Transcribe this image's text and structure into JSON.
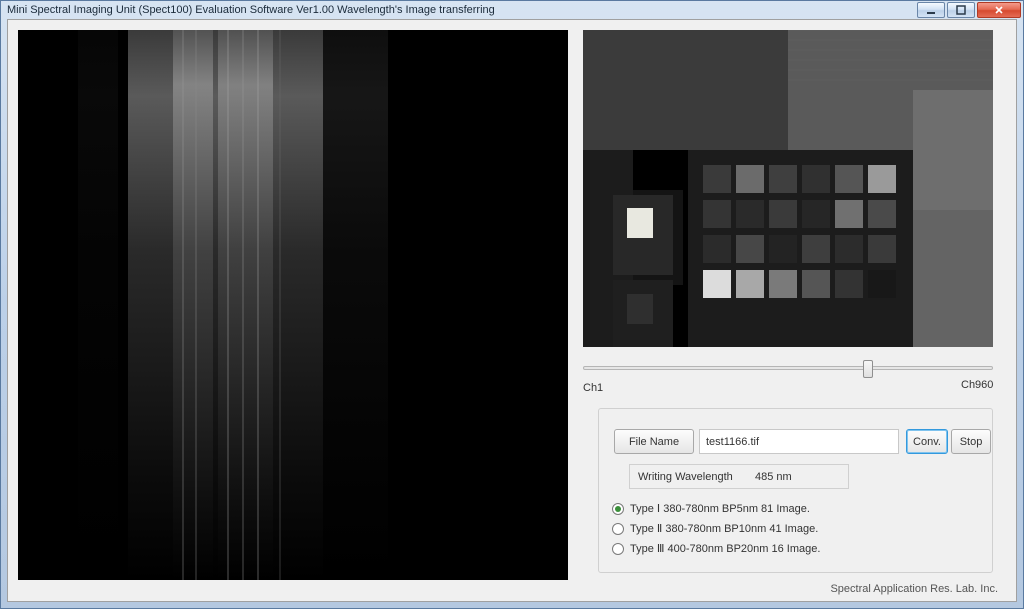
{
  "window": {
    "title": "Mini Spectral Imaging Unit (Spect100) Evaluation Software Ver1.00 Wavelength's Image transferring"
  },
  "slider": {
    "left_label": "Ch1",
    "right_label": "Ch960",
    "position_percent": 70
  },
  "controls": {
    "file_button": "File Name",
    "file_value": "test1166.tif",
    "conv_button": "Conv.",
    "stop_button": "Stop",
    "writing_wavelength_label": "Writing Wavelength",
    "writing_wavelength_value": "485 nm"
  },
  "types": {
    "options": [
      {
        "label": "Type Ⅰ 380-780nm BP5nm 81 Image.",
        "selected": true
      },
      {
        "label": "Type Ⅱ 380-780nm BP10nm 41 Image.",
        "selected": false
      },
      {
        "label": "Type Ⅲ 400-780nm BP20nm 16 Image.",
        "selected": false
      }
    ]
  },
  "brand": "Spectral Application Res. Lab. Inc."
}
